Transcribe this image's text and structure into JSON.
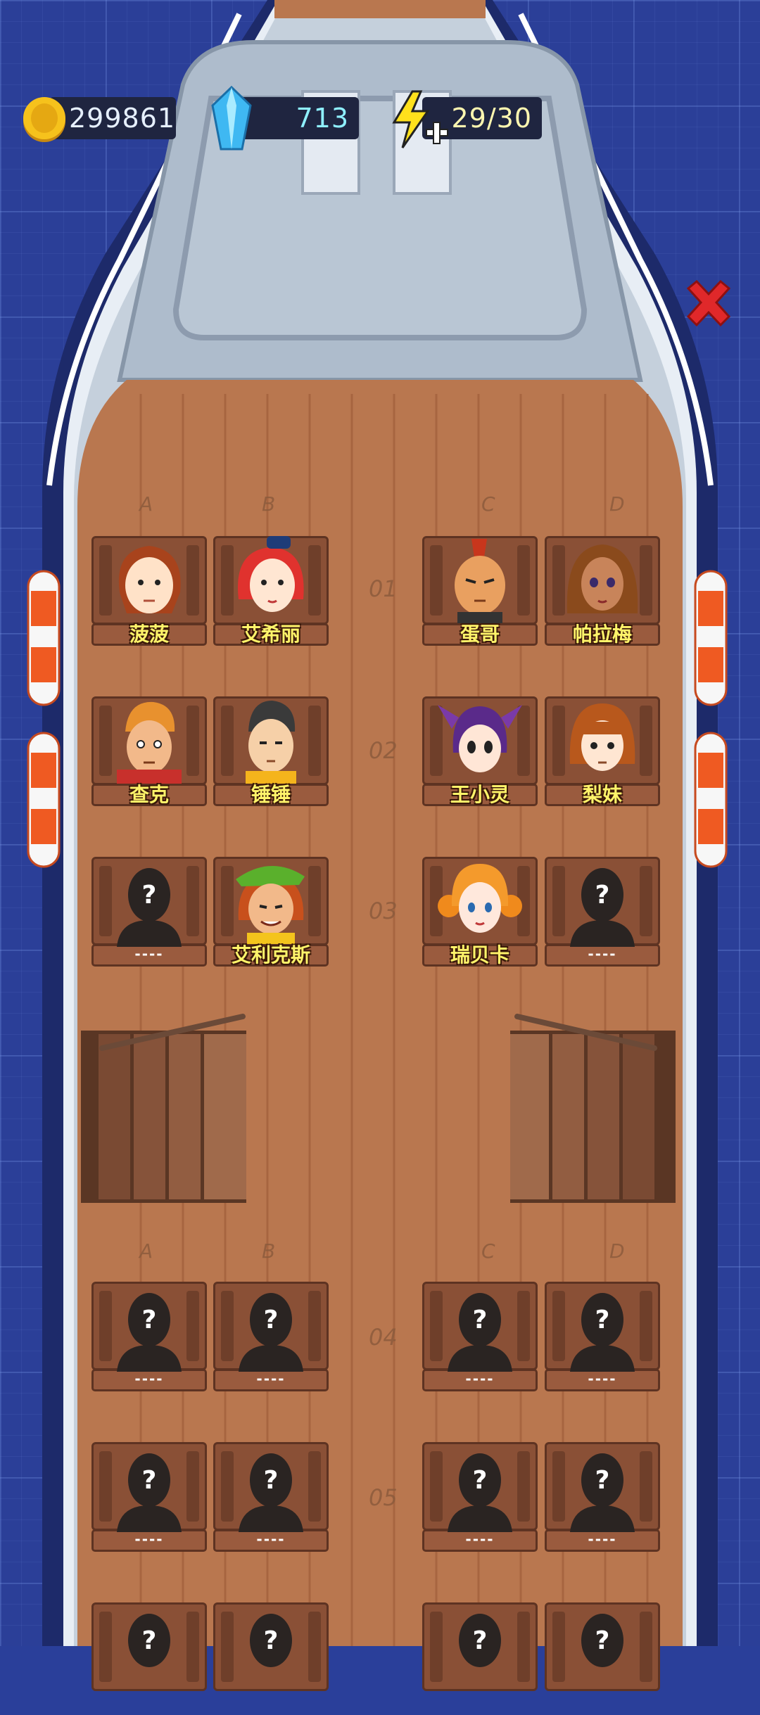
{
  "hud": {
    "coins": "299861",
    "gems": "713",
    "energy": "29/30"
  },
  "icons": {
    "coin": "gold-coin-icon",
    "gem": "blue-crystal-icon",
    "energy": "lightning-plus-icon",
    "close": "red-x-icon",
    "locked_seat": "silhouette-question-icon"
  },
  "columns": [
    "A",
    "B",
    "C",
    "D"
  ],
  "rows": [
    "01",
    "02",
    "03",
    "04",
    "05"
  ],
  "seats": {
    "r1": [
      "菠菠",
      "艾希丽",
      "蛋哥",
      "帕拉梅"
    ],
    "r2": [
      "查克",
      "锤锤",
      "王小灵",
      "梨妹"
    ],
    "r3": [
      "----",
      "艾利克斯",
      "瑞贝卡",
      "----"
    ],
    "r4": [
      "----",
      "----",
      "----",
      "----"
    ],
    "r5": [
      "----",
      "----",
      "----",
      "----"
    ]
  },
  "colors": {
    "ocean": "#2b3f98",
    "deck": "#b9774f",
    "name_text": "#fff46a",
    "close": "#e0282a"
  }
}
